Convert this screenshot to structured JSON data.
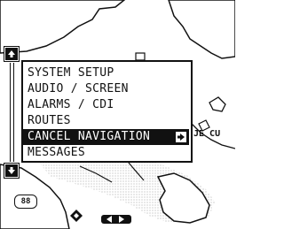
{
  "menu": {
    "items": [
      {
        "label": "SYSTEM SETUP"
      },
      {
        "label": "AUDIO / SCREEN"
      },
      {
        "label": "ALARMS / CDI"
      },
      {
        "label": "ROUTES"
      },
      {
        "label": "CANCEL NAVIGATION"
      },
      {
        "label": "MESSAGES"
      }
    ]
  },
  "map": {
    "marker_label": "88",
    "partial_label": "JE CU"
  },
  "icons": {
    "scroll_up": "arrow-up-icon",
    "scroll_down": "arrow-down-icon",
    "submenu": "arrow-right-icon",
    "cursor": "diamond-icon"
  }
}
